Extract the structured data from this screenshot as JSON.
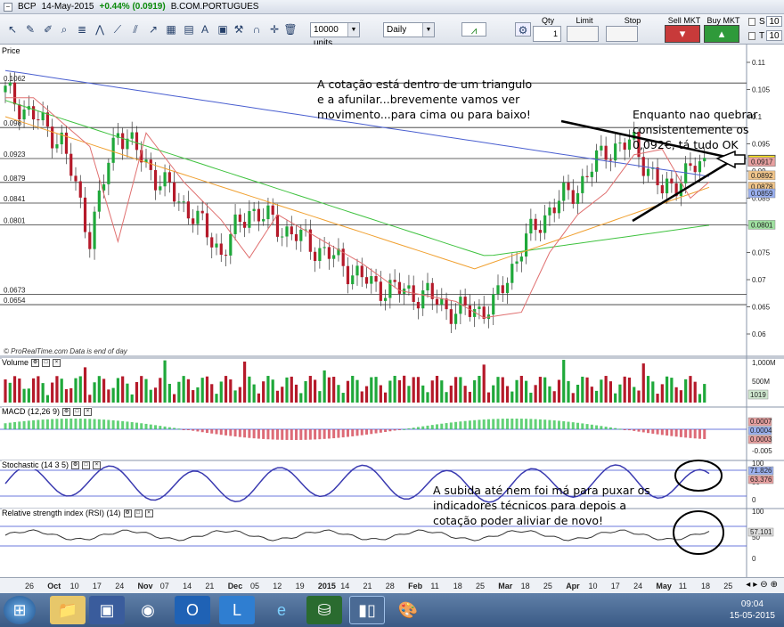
{
  "titlebar": {
    "symbol": "BCP",
    "date": "14-May-2015",
    "change": "+0.44% (0.0919)",
    "name": "B.COM.PORTUGUES"
  },
  "toolbar": {
    "units": "10000 units",
    "period": "Daily",
    "qty_label": "Qty",
    "qty_value": "1",
    "limit_label": "Limit",
    "stop_label": "Stop",
    "sell_label": "Sell MKT",
    "buy_label": "Buy MKT",
    "s_label": "S",
    "s_value": "10",
    "t_label": "T",
    "t_value": "10"
  },
  "chart_data": {
    "type": "candlestick",
    "price_axis": [
      "0.11",
      "0.105",
      "0.1",
      "0.095",
      "0.09",
      "0.085",
      "0.08",
      "0.075",
      "0.07",
      "0.065",
      "0.06"
    ],
    "horizontal_levels": [
      "0.1062",
      "0.098",
      "0.0923",
      "0.0879",
      "0.0841",
      "0.0801",
      "0.0673",
      "0.0654"
    ],
    "last_price": "0.0919",
    "side_tags": [
      "0.0917",
      "0.0892",
      "0.0878",
      "0.0859",
      "0.0801"
    ],
    "date_axis": [
      "26",
      "Oct",
      "10",
      "17",
      "24",
      "Nov",
      "07",
      "14",
      "21",
      "Dec",
      "05",
      "12",
      "19",
      "2015",
      "14",
      "21",
      "28",
      "Feb",
      "11",
      "18",
      "25",
      "Mar",
      "18",
      "25",
      "Apr",
      "10",
      "17",
      "24",
      "May",
      "11",
      "18",
      "25"
    ],
    "volume_axis": [
      "1,000M",
      "500M"
    ],
    "volume_tag": "1019",
    "macd_axis": [
      "-0.005"
    ],
    "macd_tags": [
      "0.0007",
      "0.0004",
      "0.0003"
    ],
    "stoch_axis": [
      "100",
      "50",
      "0"
    ],
    "stoch_tags": [
      "71.826",
      "63.376"
    ],
    "rsi_axis": [
      "100",
      "50",
      "0"
    ],
    "rsi_tag": "57.101"
  },
  "panels": {
    "price": "Price",
    "volume": "Volume",
    "macd": "MACD (12,26 9)",
    "stoch": "Stochastic (14 3 5)",
    "rsi": "Relative strength index (RSI) (14)",
    "credit": "© ProRealTime.com  Data is end of day"
  },
  "annotations": {
    "a1_l1": "A cotação está dentro de um triangulo",
    "a1_l2": "e a afunilar...brevemente vamos ver",
    "a1_l3": "movimento...para cima ou para baixo!",
    "a2_l1": "Enquanto nao quebrar",
    "a2_l2": "consistentemente os",
    "a2_l3": "0,092€, tá tudo OK",
    "a3_l1": "A subida até nem foi má para puxar os",
    "a3_l2": "indicadores técnicos para depois a",
    "a3_l3": "cotação poder aliviar de novo!"
  },
  "taskbar": {
    "time": "09:04",
    "date": "15-05-2015"
  }
}
